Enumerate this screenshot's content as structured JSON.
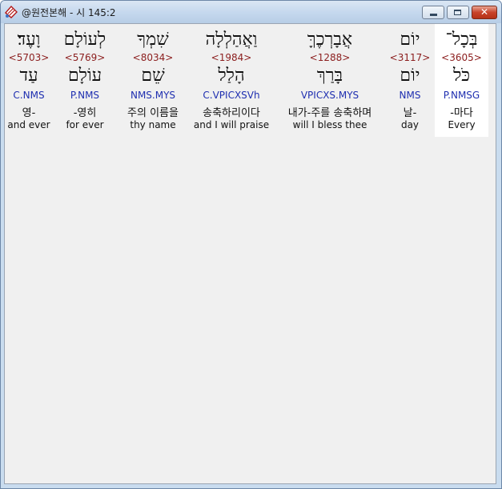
{
  "window": {
    "title": "@원전본해 - 시 145:2",
    "close_glyph": "✕"
  },
  "words": [
    {
      "hebrew": "בְּכָל־",
      "strong": "<3605>",
      "lemma": "כֹּל",
      "morph": "P.NMSG",
      "korean": "-마다",
      "english": "Every"
    },
    {
      "hebrew": "יוֹם",
      "strong": "<3117>",
      "lemma": "יוֹם",
      "morph": "NMS",
      "korean": "날-",
      "english": "day"
    },
    {
      "hebrew": "אֲבָרְכֶךָּ",
      "strong": "<1288>",
      "lemma": "בָּרַךְ",
      "morph": "VPICXS.MYS",
      "korean": "내가-주를 송축하며",
      "english": "will I bless thee"
    },
    {
      "hebrew": "וַאֲהַלְלָה",
      "strong": "<1984>",
      "lemma": "הָלַל",
      "morph": "C.VPICXSVh",
      "korean": "송축하리이다",
      "english": "and I will praise"
    },
    {
      "hebrew": "שִׁמְךָ",
      "strong": "<8034>",
      "lemma": "שֵׁם",
      "morph": "NMS.MYS",
      "korean": "주의 이름을",
      "english": "thy name"
    },
    {
      "hebrew": "לְעוֹלָם",
      "strong": "<5769>",
      "lemma": "עוֹלָם",
      "morph": "P.NMS",
      "korean": "-영히",
      "english": "for ever"
    },
    {
      "hebrew": "וָעֶד׃",
      "strong": "<5703>",
      "lemma": "עַד",
      "morph": "C.NMS",
      "korean": "영-",
      "english": "and ever"
    }
  ]
}
